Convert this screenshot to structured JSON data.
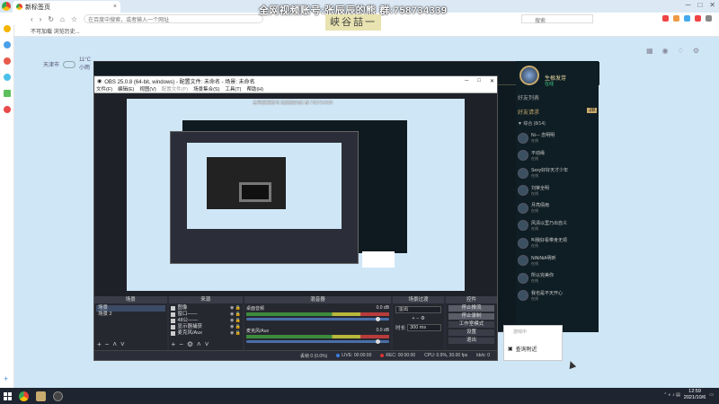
{
  "browser": {
    "tab_title": "新标签页",
    "address_placeholder": "在百度中搜索，或者输入一个网址",
    "bookmark_1": "不可加载 浏览历史...",
    "ext_search_label": "搜索"
  },
  "overlay": {
    "top_text": "全网视频账号:张辰辰的熊  群:758734339",
    "badge": "峡谷喆一"
  },
  "weather": {
    "city": "天津市",
    "temp": "11°C",
    "condition": "小雨"
  },
  "lol": {
    "player_name": "生根发芽",
    "player_status": "在线",
    "friends_header": "好友列表",
    "friend_request": "好友请求",
    "friend_request_count": "28",
    "group_label": "▼ 综合 (8/14)",
    "friends": [
      {
        "name": "Ni--- 念明明",
        "status": "在线"
      },
      {
        "name": "不动缘",
        "status": "在线"
      },
      {
        "name": "Sexy好好天才少年",
        "status": "在线"
      },
      {
        "name": "刘荣全明",
        "status": "在线"
      },
      {
        "name": "月亮倩雨",
        "status": "在线"
      },
      {
        "name": "风清以里乃出自义",
        "status": "在线"
      },
      {
        "name": "叫我好看带身无领",
        "status": "在线"
      },
      {
        "name": "NiNiNiA明昕",
        "status": "在线"
      },
      {
        "name": "所以完美你",
        "status": "在线"
      },
      {
        "name": "我也是不天开心",
        "status": "在线"
      }
    ],
    "popup_sub": "游戏中",
    "popup_text": "查询附近"
  },
  "obs": {
    "title": "OBS 25.0.8 (64-bit, windows) - 配置文件: 未命名 - 场景: 未命名",
    "menu": [
      "文件(F)",
      "编辑(E)",
      "视图(V)",
      "配置文件(P)",
      "场景集合(S)",
      "工具(T)",
      "帮助(H)"
    ],
    "preview_overlay": "全网视频账号:张辰辰的熊 群:758734339",
    "docks": {
      "scenes": "场景",
      "sources": "来源",
      "mixer": "混音器",
      "transitions": "场景过渡",
      "controls": "控件"
    },
    "scenes": [
      "场景",
      "场景 2"
    ],
    "sources": [
      "图像",
      "窗口——",
      "48公——",
      "显示器捕获",
      "麦克风/Aux"
    ],
    "mixer": [
      {
        "name": "桌面音频",
        "db": "0.0 dB"
      },
      {
        "name": "麦克风/Aux",
        "db": "0.0 dB"
      }
    ],
    "transition_value": "淡出",
    "duration_label": "时长",
    "duration_value": "300 ms",
    "controls": [
      "停止推流",
      "停止录制",
      "工作室模式",
      "设置",
      "退出"
    ],
    "status": {
      "dropped": "丢帧 0 (0.0%)",
      "live": "LIVE: 00:00:00",
      "rec": "REC: 00:00:00",
      "cpu": "CPU: 0.9%, 30.00 fps",
      "kbps": "kb/s: 0"
    }
  },
  "taskbar": {
    "time": "12:59",
    "date": "2021/10/6"
  }
}
